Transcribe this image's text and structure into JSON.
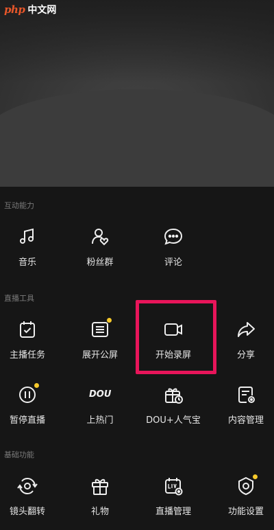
{
  "watermark": {
    "logo": "php",
    "site": "中文网"
  },
  "sections": [
    {
      "title": "互动能力",
      "items": [
        {
          "label": "音乐",
          "icon": "music-note-icon",
          "dot": false
        },
        {
          "label": "粉丝群",
          "icon": "fan-group-icon",
          "dot": false
        },
        {
          "label": "评论",
          "icon": "comment-icon",
          "dot": false
        }
      ]
    },
    {
      "title": "直播工具",
      "items": [
        {
          "label": "主播任务",
          "icon": "task-calendar-icon",
          "dot": false
        },
        {
          "label": "展开公屏",
          "icon": "public-screen-icon",
          "dot": true
        },
        {
          "label": "开始录屏",
          "icon": "screen-record-icon",
          "dot": false
        },
        {
          "label": "分享",
          "icon": "share-icon",
          "dot": false
        },
        {
          "label": "暂停直播",
          "icon": "pause-icon",
          "dot": true
        },
        {
          "label": "上热门",
          "icon": "dou-icon",
          "dot": false,
          "icon_text": "DOU"
        },
        {
          "label": "DOU+人气宝",
          "icon": "popularity-gift-icon",
          "dot": false
        },
        {
          "label": "内容管理",
          "icon": "content-manage-icon",
          "dot": false
        }
      ]
    },
    {
      "title": "基础功能",
      "items": [
        {
          "label": "镜头翻转",
          "icon": "camera-flip-icon",
          "dot": false
        },
        {
          "label": "礼物",
          "icon": "gift-icon",
          "dot": false
        },
        {
          "label": "直播管理",
          "icon": "live-manage-icon",
          "dot": false
        },
        {
          "label": "功能设置",
          "icon": "settings-shield-icon",
          "dot": true
        }
      ]
    }
  ],
  "colors": {
    "accent_dot": "#f6c92b",
    "highlight": "#e8155a"
  }
}
